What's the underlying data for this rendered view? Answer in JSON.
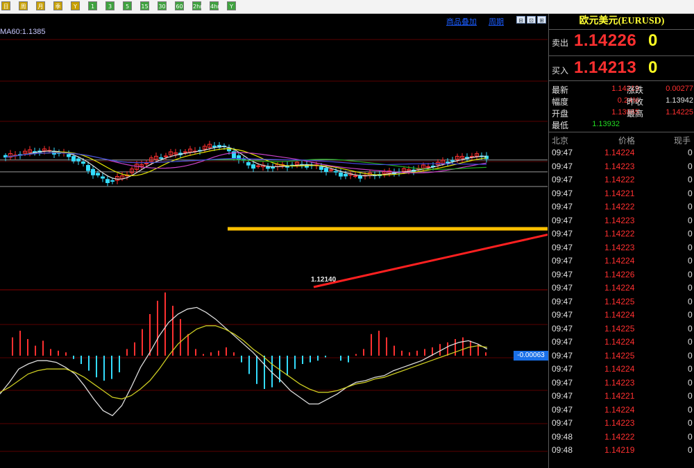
{
  "toolbar": {
    "buttons": [
      {
        "label": "日",
        "color": "#c8a000"
      },
      {
        "label": "周",
        "color": "#c8a000"
      },
      {
        "label": "月",
        "color": "#c8a000"
      },
      {
        "label": "季",
        "color": "#c8a000"
      },
      {
        "label": "Y",
        "color": "#c8a000"
      },
      {
        "label": "1",
        "color": "#3fa23f"
      },
      {
        "label": "3",
        "color": "#3fa23f"
      },
      {
        "label": "5",
        "color": "#3fa23f"
      },
      {
        "label": "15",
        "color": "#3fa23f"
      },
      {
        "label": "30",
        "color": "#3fa23f"
      },
      {
        "label": "60",
        "color": "#3fa23f"
      },
      {
        "label": "2hr",
        "color": "#3fa23f"
      },
      {
        "label": "4hr",
        "color": "#3fa23f"
      },
      {
        "label": "Y",
        "color": "#3fa23f"
      }
    ]
  },
  "chart_header": {
    "overlay_link": "商品叠加",
    "period_link": "周期",
    "ma_label": "MA60:1.1385"
  },
  "annotations": {
    "low_price_label": "1.12140",
    "macd_value": "-0.00063"
  },
  "colors": {
    "up": "#ff3030",
    "down": "#33ddff",
    "yellow_arrow": "#ffc000",
    "red_arrow": "#ff2020",
    "ma_white": "#e0e0e0",
    "ma_yellow": "#e6e600",
    "ma_purple": "#cc44cc",
    "ma_green": "#22aa22",
    "ma_blue": "#4444dd"
  },
  "chart_data": {
    "type": "candlestick",
    "ylim": [
      1.1195,
      1.1465
    ],
    "reference_lines": [
      1.1415,
      1.1394,
      1.1368
    ],
    "macd_ylim": [
      -0.004,
      0.004
    ],
    "macd_histogram": [
      1.1,
      1.5,
      1.0,
      0.6,
      0.9,
      0.4,
      0.3,
      0.2,
      -0.2,
      -0.5,
      -0.9,
      -1.3,
      -1.5,
      -1.4,
      -1.0,
      0.4,
      0.8,
      1.6,
      2.5,
      3.3,
      3.8,
      3.0,
      2.2,
      1.3,
      0.4,
      0.1,
      0.2,
      0.3,
      0.5,
      0.2,
      -0.4,
      -1.1,
      -1.7,
      -2.0,
      -1.9,
      -1.6,
      -1.2,
      -0.8,
      -0.5,
      -0.4,
      -0.3,
      -0.1,
      0.0,
      -0.3,
      -0.4,
      0.1,
      0.4,
      1.3,
      1.5,
      1.1,
      0.6,
      0.3,
      0.2,
      0.3,
      0.4,
      0.5,
      0.7,
      0.8,
      1.0,
      1.1,
      0.9,
      0.7,
      0.2
    ],
    "macd_dif": [
      -2.3,
      -1.6,
      -0.8,
      -0.5,
      -0.3,
      -0.3,
      -0.4,
      -0.7,
      -1.1,
      -1.8,
      -2.6,
      -3.3,
      -3.6,
      -3.0,
      -1.9,
      -0.7,
      0.2,
      1.2,
      2.0,
      2.5,
      2.8,
      2.9,
      2.6,
      2.2,
      1.7,
      1.2,
      0.7,
      0.2,
      -0.4,
      -1.0,
      -1.5,
      -2.1,
      -2.5,
      -2.9,
      -2.9,
      -2.6,
      -2.3,
      -1.9,
      -1.6,
      -1.5,
      -1.3,
      -1.2,
      -0.9,
      -0.7,
      -0.5,
      -0.3,
      0.0,
      0.3,
      0.6,
      0.8,
      0.9,
      0.7,
      0.4
    ],
    "macd_dea": [
      -2.2,
      -1.9,
      -1.5,
      -1.1,
      -0.9,
      -0.8,
      -0.8,
      -0.8,
      -1.0,
      -1.3,
      -1.7,
      -2.1,
      -2.5,
      -2.6,
      -2.4,
      -2.0,
      -1.5,
      -0.8,
      0.0,
      0.7,
      1.2,
      1.6,
      1.8,
      1.8,
      1.6,
      1.3,
      0.9,
      0.4,
      0.0,
      -0.5,
      -0.9,
      -1.3,
      -1.7,
      -2.0,
      -2.2,
      -2.2,
      -2.1,
      -1.9,
      -1.7,
      -1.6,
      -1.4,
      -1.3,
      -1.1,
      -0.9,
      -0.7,
      -0.5,
      -0.3,
      -0.1,
      0.1,
      0.3,
      0.5,
      0.6,
      0.5
    ]
  },
  "panel": {
    "title": "欧元美元(EURUSD)",
    "sell_label": "卖出",
    "sell_price": "1.14226",
    "sell_volume": "0",
    "buy_label": "买入",
    "buy_price": "1.14213",
    "buy_volume": "0",
    "stats": [
      {
        "label": "最新",
        "value": "1.14219",
        "color": "#ff3030"
      },
      {
        "label": "涨跌",
        "value": "0.00277",
        "color": "#ff3030"
      },
      {
        "label": "幅度",
        "value": "0.24%",
        "color": "#ff3030"
      },
      {
        "label": "昨收",
        "value": "1.13942",
        "color": "#e0e0e0"
      },
      {
        "label": "开盘",
        "value": "1.13965",
        "color": "#ff3030"
      },
      {
        "label": "最高",
        "value": "1.14225",
        "color": "#ff3030"
      },
      {
        "label": "最低",
        "value": "1.13932",
        "color": "#22dd22"
      }
    ],
    "tick_headers": {
      "time": "北京",
      "price": "价格",
      "volume": "现手"
    },
    "ticks": [
      {
        "time": "09:47",
        "price": "1.14224",
        "volume": "0"
      },
      {
        "time": "09:47",
        "price": "1.14223",
        "volume": "0"
      },
      {
        "time": "09:47",
        "price": "1.14222",
        "volume": "0"
      },
      {
        "time": "09:47",
        "price": "1.14221",
        "volume": "0"
      },
      {
        "time": "09:47",
        "price": "1.14222",
        "volume": "0"
      },
      {
        "time": "09:47",
        "price": "1.14223",
        "volume": "0"
      },
      {
        "time": "09:47",
        "price": "1.14222",
        "volume": "0"
      },
      {
        "time": "09:47",
        "price": "1.14223",
        "volume": "0"
      },
      {
        "time": "09:47",
        "price": "1.14224",
        "volume": "0"
      },
      {
        "time": "09:47",
        "price": "1.14226",
        "volume": "0"
      },
      {
        "time": "09:47",
        "price": "1.14224",
        "volume": "0"
      },
      {
        "time": "09:47",
        "price": "1.14225",
        "volume": "0"
      },
      {
        "time": "09:47",
        "price": "1.14224",
        "volume": "0"
      },
      {
        "time": "09:47",
        "price": "1.14225",
        "volume": "0"
      },
      {
        "time": "09:47",
        "price": "1.14224",
        "volume": "0"
      },
      {
        "time": "09:47",
        "price": "1.14225",
        "volume": "0"
      },
      {
        "time": "09:47",
        "price": "1.14224",
        "volume": "0"
      },
      {
        "time": "09:47",
        "price": "1.14223",
        "volume": "0"
      },
      {
        "time": "09:47",
        "price": "1.14221",
        "volume": "0"
      },
      {
        "time": "09:47",
        "price": "1.14224",
        "volume": "0"
      },
      {
        "time": "09:47",
        "price": "1.14223",
        "volume": "0"
      },
      {
        "time": "09:48",
        "price": "1.14222",
        "volume": "0"
      },
      {
        "time": "09:48",
        "price": "1.14219",
        "volume": "0"
      }
    ]
  }
}
